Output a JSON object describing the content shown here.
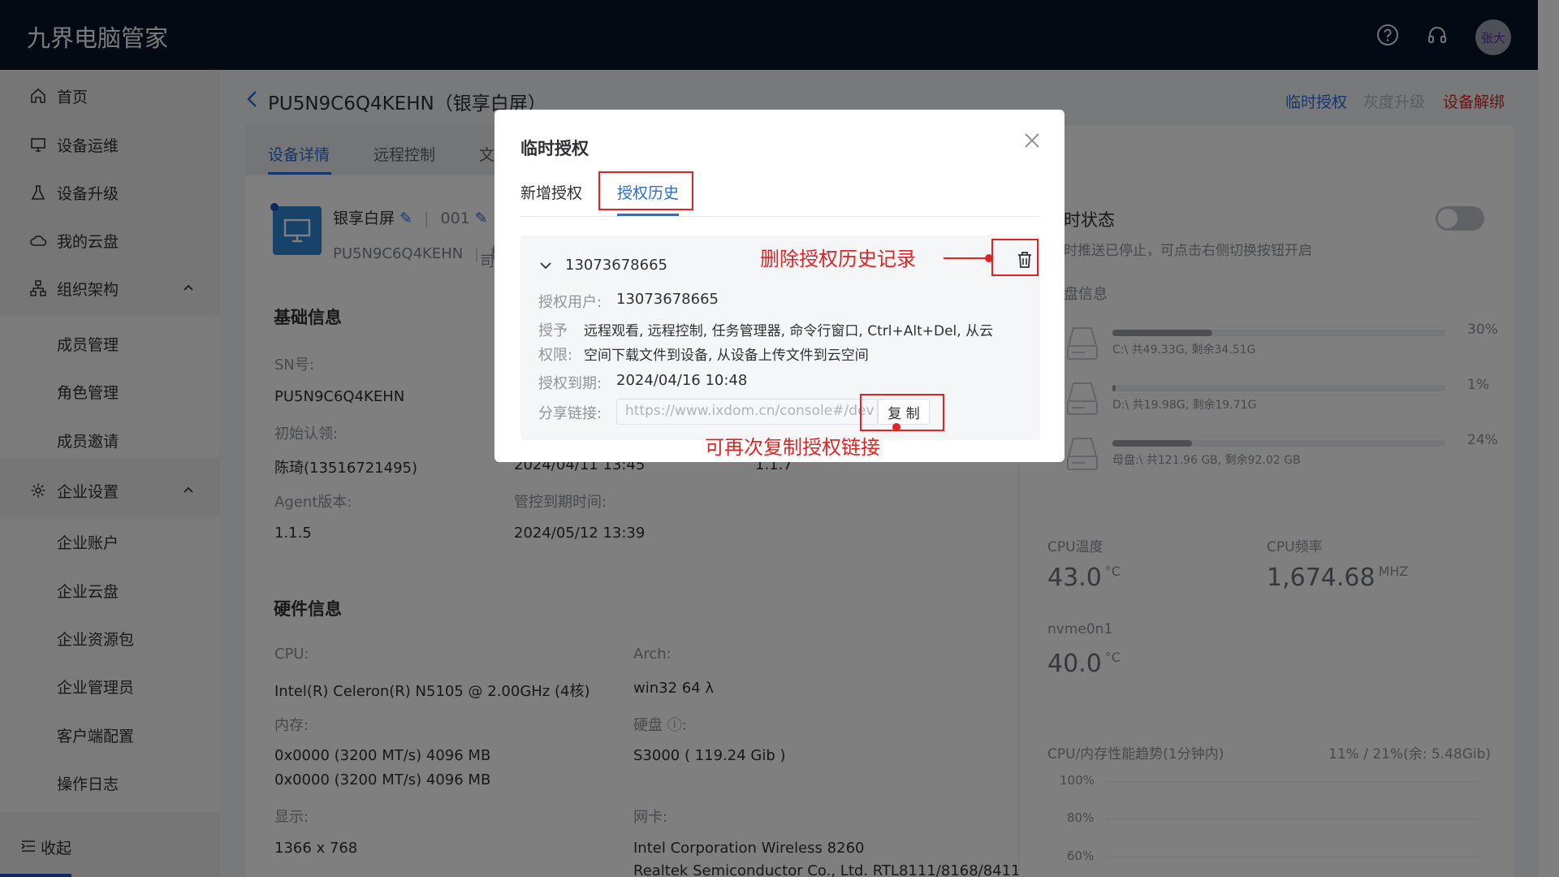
{
  "app": {
    "brand": "九界电脑管家",
    "user_avatar": "张大"
  },
  "colors": {
    "accent": "#2b6cd9",
    "danger": "#e02424",
    "topbar": "#061427"
  },
  "sidebar": {
    "items": [
      {
        "label": "首页",
        "icon": "home-icon"
      },
      {
        "label": "设备运维",
        "icon": "monitor-icon"
      },
      {
        "label": "设备升级",
        "icon": "flask-icon"
      },
      {
        "label": "我的云盘",
        "icon": "cloud-icon"
      },
      {
        "label": "组织架构",
        "icon": "org-icon"
      },
      {
        "label": "企业设置",
        "icon": "gear-icon"
      }
    ],
    "org_sub": [
      "成员管理",
      "角色管理",
      "成员邀请"
    ],
    "ent_sub": [
      "企业账户",
      "企业云盘",
      "企业资源包",
      "企业管理员",
      "客户端配置",
      "操作日志"
    ],
    "collapse": "收起"
  },
  "page": {
    "title": "PU5N9C6Q4KEHN（银享白屏）",
    "actions": {
      "temp_auth": "临时授权",
      "gray_upgrade": "灰度升级",
      "unbind": "设备解绑"
    },
    "tabs": [
      "设备详情",
      "远程控制",
      "文"
    ],
    "device": {
      "name": "银享白屏",
      "code": "001",
      "sn": "PU5N9C6Q4KEHN",
      "extra": "杭",
      "extra2": "司"
    }
  },
  "basic": {
    "title": "基础信息",
    "sn_label": "SN号:",
    "sn_value": "PU5N9C6Q4KEHN",
    "claim_label": "初始认领:",
    "claim_value": "陈琦(13516721495)",
    "claim_time_partial": "2024/04/11 13:45",
    "ver_partial": "1.1.7",
    "agent_label": "Agent版本:",
    "agent_value": "1.1.5",
    "expire_label": "管控到期时间:",
    "expire_value": "2024/05/12 13:39"
  },
  "hardware": {
    "title": "硬件信息",
    "cpu_label": "CPU:",
    "cpu_value": "Intel(R) Celeron(R) N5105 @ 2.00GHz (4核)",
    "arch_label": "Arch:",
    "arch_value": "win32 64 λ",
    "mem_label": "内存:",
    "mem_value_1": "0x0000 (3200 MT/s) 4096 MB",
    "mem_value_2": "0x0000 (3200 MT/s) 4096 MB",
    "disk_label": "硬盘",
    "disk_value": "S3000 ( 119.24 Gib )",
    "display_label": "显示:",
    "display_value": "1366 x 768",
    "nic_label": "网卡:",
    "nic_value_1": "Intel Corporation Wireless 8260",
    "nic_value_2": "Realtek Semiconductor Co., Ltd. RTL8111/8168/8411"
  },
  "right_panel": {
    "status_title": "时状态",
    "status_sub": "时推送已停止，可点击右侧切换按钮开启",
    "disk_title": "盘信息",
    "disks": [
      {
        "info": "C:\\ 共49.33G, 剩余34.51G",
        "pct_text": "30%",
        "pct": 30
      },
      {
        "info": "D:\\ 共19.98G, 剩余19.71G",
        "pct_text": "1%",
        "pct": 1
      },
      {
        "info": "母盘:\\ 共121.96 GB, 剩余92.02 GB",
        "pct_text": "24%",
        "pct": 24
      }
    ],
    "cpu_temp_label": "CPU温度",
    "cpu_temp": "43.0",
    "cpu_freq_label": "CPU频率",
    "cpu_freq": "1,674.68",
    "freq_unit": "MHZ",
    "temp_unit": "°C",
    "nvme_label": "nvme0n1",
    "nvme_temp": "40.0",
    "trend_label": "CPU/内存性能趋势(1分钟内)",
    "trend_value": "11% / 21%(余: 5.48Gib)",
    "y_ticks": [
      "100%",
      "80%",
      "60%"
    ]
  },
  "modal": {
    "title": "临时授权",
    "tab_new": "新增授权",
    "tab_history": "授权历史",
    "phone": "13073678665",
    "user_label": "授权用户:",
    "user_value": "13073678665",
    "perm_label_1": "授予",
    "perm_label_2": "权限:",
    "perm_line_1": "远程观看, 远程控制, 任务管理器, 命令行窗口, Ctrl+Alt+Del, 从云",
    "perm_line_2": "空间下载文件到设备, 从设备上传文件到云空间",
    "expire_label": "授权到期:",
    "expire_value": "2024/04/16 10:48",
    "share_label": "分享链接:",
    "share_url": "https://www.ixdom.cn/console#/dev",
    "copy_label": "复 制"
  },
  "annotations": {
    "delete_note": "删除授权历史记录",
    "copy_note": "可再次复制授权链接"
  }
}
